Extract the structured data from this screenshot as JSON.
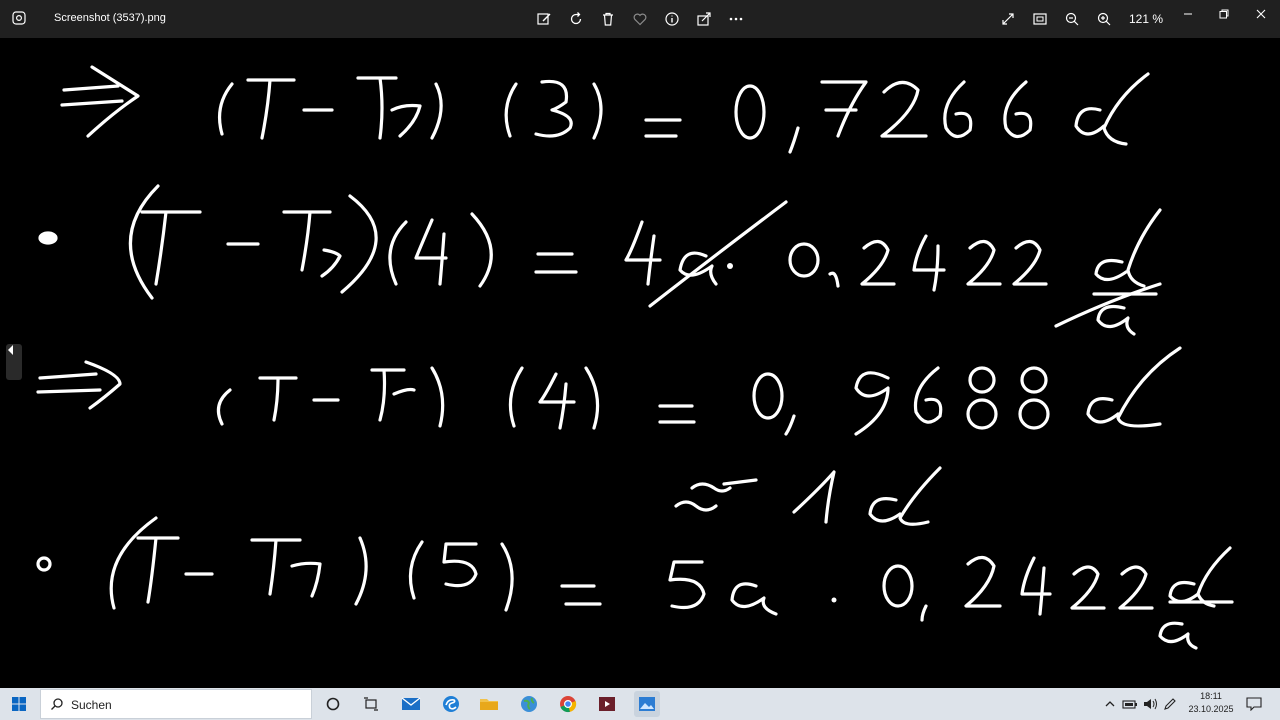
{
  "window": {
    "title": "Screenshot (3537).png"
  },
  "toolbar": {
    "zoom_level": "121 %"
  },
  "handwriting": {
    "line1": "⇒ (T−T1)(3) = 0,7266d",
    "line2": "• (T−T1)(4) = 4a · 0,2422 d/a",
    "line3": "⇒ (T−T1)(4) = 0,9688d",
    "line3b": "≈ 1d",
    "line4": "• (T−T1)(5) = 5a · 0,2422 d/a"
  },
  "taskbar": {
    "search_placeholder": "Suchen"
  },
  "clock": {
    "time": "18:11",
    "date": "23.10.2025"
  }
}
